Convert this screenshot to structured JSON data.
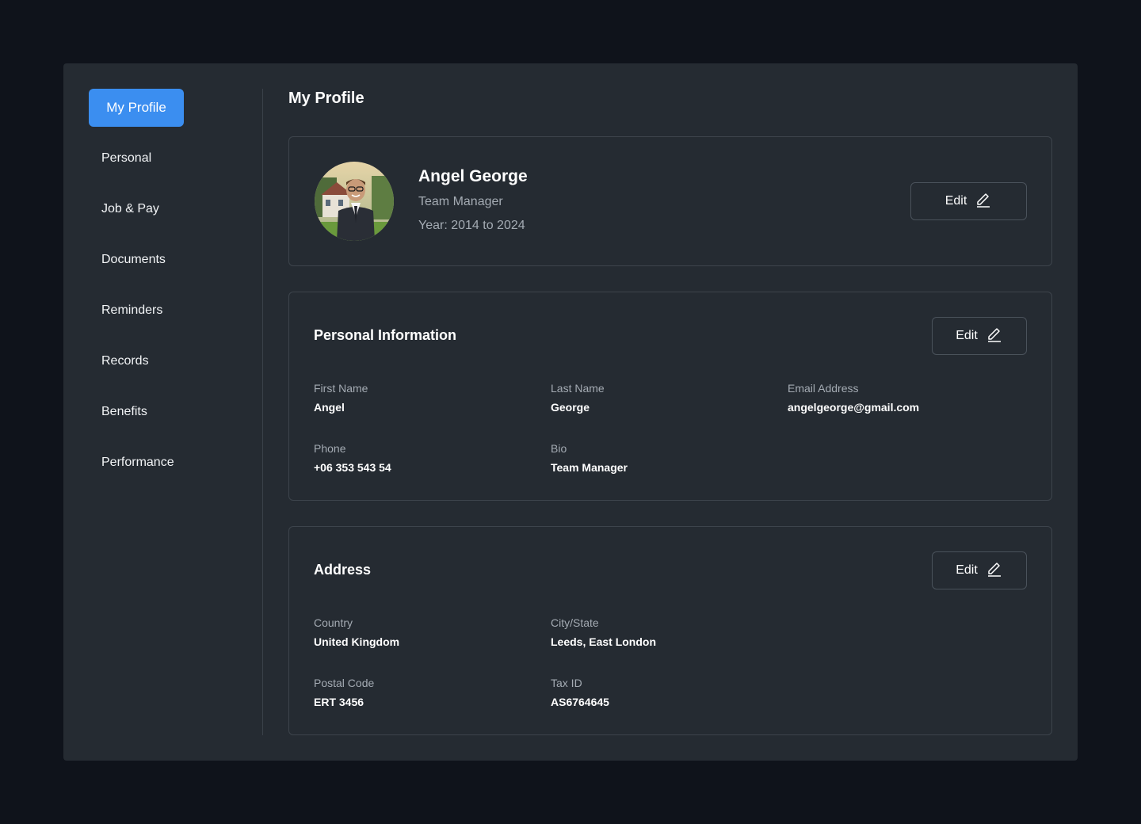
{
  "sidebar": {
    "active_label": "My Profile",
    "items": [
      "Personal",
      "Job & Pay",
      "Documents",
      "Reminders",
      "Records",
      "Benefits",
      "Performance"
    ]
  },
  "page": {
    "title": "My Profile"
  },
  "profile": {
    "name": "Angel George",
    "role": "Team Manager",
    "years": "Year: 2014 to 2024",
    "edit_label": "Edit"
  },
  "personal": {
    "title": "Personal Information",
    "edit_label": "Edit",
    "first_name_label": "First Name",
    "first_name": "Angel",
    "last_name_label": "Last Name",
    "last_name": "George",
    "email_label": "Email Address",
    "email": "angelgeorge@gmail.com",
    "phone_label": "Phone",
    "phone": "+06 353 543 54",
    "bio_label": "Bio",
    "bio": "Team Manager"
  },
  "address": {
    "title": "Address",
    "edit_label": "Edit",
    "country_label": "Country",
    "country": "United Kingdom",
    "city_label": "City/State",
    "city": "Leeds, East London",
    "postal_label": "Postal Code",
    "postal": "ERT 3456",
    "tax_label": "Tax ID",
    "tax": "AS6764645"
  },
  "icons": {
    "edit": "pencil-icon"
  },
  "colors": {
    "accent": "#3b8ef0",
    "panel": "#252b32",
    "background": "#0f131b"
  }
}
